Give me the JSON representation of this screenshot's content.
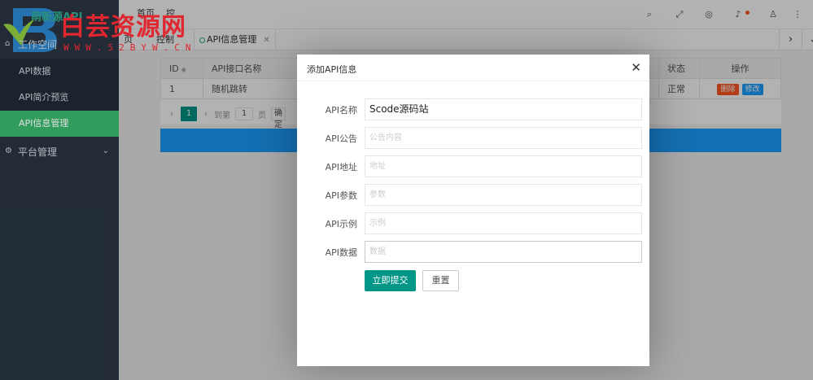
{
  "app": {
    "logo_text": "萌新源API",
    "watermark_title": "白芸资源网",
    "watermark_url": "WWW.52BYW.CN",
    "accent": "#009688",
    "sidebar_bg": "#28333e",
    "active_green": "#37b36a"
  },
  "sidebar": {
    "workspace_label": "工作空间",
    "items": [
      {
        "label": "API数据"
      },
      {
        "label": "API简介预览"
      },
      {
        "label": "API信息管理"
      }
    ],
    "platform_label": "平台管理"
  },
  "header": {
    "frag_left": "首页",
    "frag_right": "控",
    "icons": [
      "search-icon",
      "fullscreen-icon",
      "globe-icon",
      "bell-icon",
      "user-icon",
      "more-icon"
    ]
  },
  "tabs": {
    "frag1": "页",
    "frag2": "控制",
    "active_label": "API信息管理"
  },
  "table": {
    "headers": [
      "ID",
      "API接口名称",
      "状态",
      "操作"
    ],
    "rows": [
      {
        "id": "1",
        "name": "随机跳转",
        "status": "正常",
        "del": "删除",
        "edit": "修改"
      }
    ],
    "pager": {
      "current": "1",
      "to_label": "到第",
      "page_value": "1",
      "unit": "页",
      "go": "确定"
    }
  },
  "modal": {
    "title": "添加API信息",
    "fields": [
      {
        "label": "API名称",
        "value": "Scode源码站"
      },
      {
        "label": "API公告",
        "value": "公告内容"
      },
      {
        "label": "API地址",
        "value": "地址"
      },
      {
        "label": "API参数",
        "value": "参数"
      },
      {
        "label": "API示例",
        "value": "示例"
      },
      {
        "label": "API数据",
        "value": "数据"
      }
    ],
    "submit": "立即提交",
    "reset": "重置"
  }
}
